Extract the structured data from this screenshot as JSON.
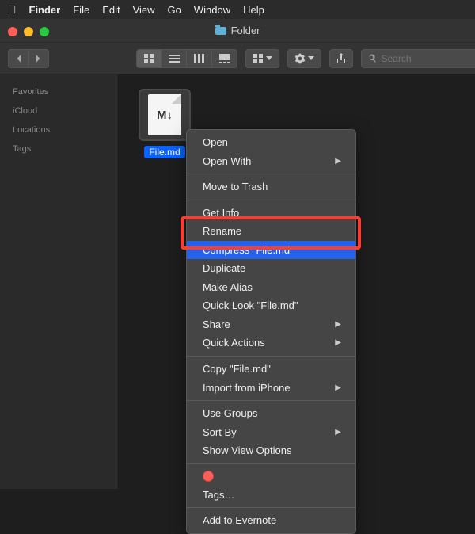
{
  "menubar": {
    "app": "Finder",
    "items": [
      "File",
      "Edit",
      "View",
      "Go",
      "Window",
      "Help"
    ]
  },
  "window": {
    "title": "Folder",
    "search_placeholder": "Search"
  },
  "sidebar": {
    "sections": [
      "Favorites",
      "iCloud",
      "Locations",
      "Tags"
    ]
  },
  "file": {
    "name": "File.md",
    "glyph": "M↓"
  },
  "context_menu": {
    "groups": [
      [
        {
          "label": "Open",
          "sub": false
        },
        {
          "label": "Open With",
          "sub": true
        }
      ],
      [
        {
          "label": "Move to Trash",
          "sub": false
        }
      ],
      [
        {
          "label": "Get Info",
          "sub": false
        },
        {
          "label": "Rename",
          "sub": false
        },
        {
          "label": "Compress \"File.md\"",
          "sub": false,
          "selected": true
        },
        {
          "label": "Duplicate",
          "sub": false
        },
        {
          "label": "Make Alias",
          "sub": false
        },
        {
          "label": "Quick Look \"File.md\"",
          "sub": false
        },
        {
          "label": "Share",
          "sub": true
        },
        {
          "label": "Quick Actions",
          "sub": true
        }
      ],
      [
        {
          "label": "Copy \"File.md\"",
          "sub": false
        },
        {
          "label": "Import from iPhone",
          "sub": true
        }
      ],
      [
        {
          "label": "Use Groups",
          "sub": false
        },
        {
          "label": "Sort By",
          "sub": true
        },
        {
          "label": "Show View Options",
          "sub": false
        }
      ],
      [
        {
          "label": "Tags…",
          "sub": false,
          "tags": true
        }
      ],
      [
        {
          "label": "Add to Evernote",
          "sub": false
        }
      ]
    ]
  }
}
